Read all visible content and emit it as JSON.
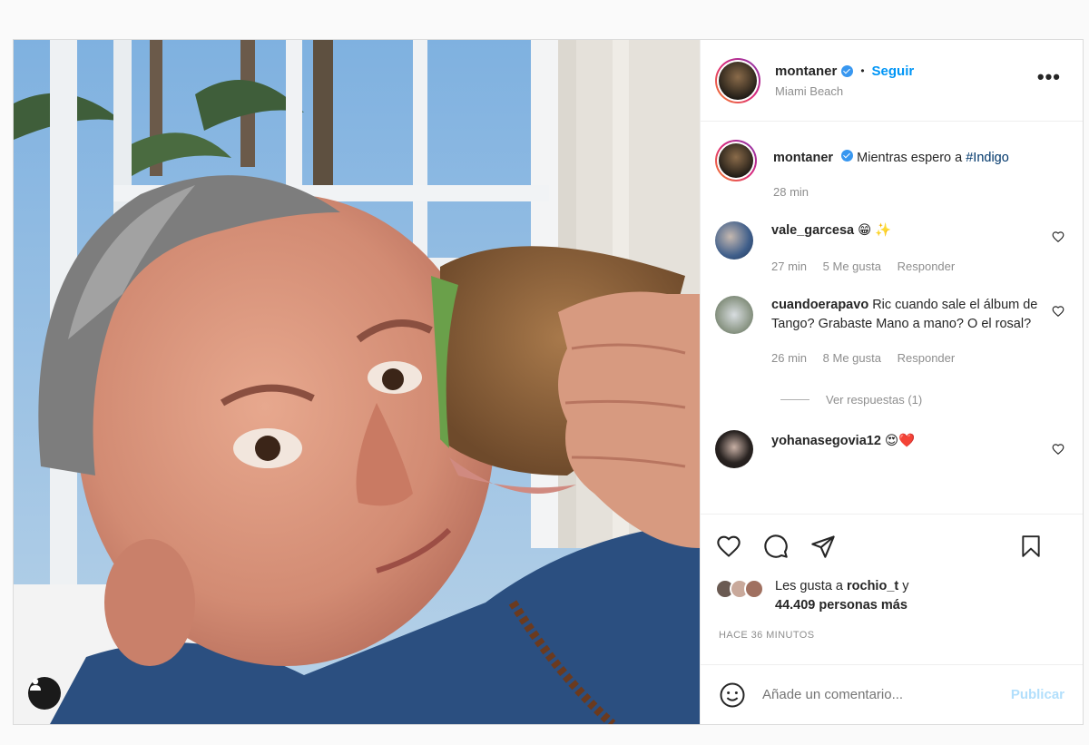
{
  "post": {
    "author": "montaner",
    "location": "Miami Beach",
    "follow_label": "Seguir",
    "separator": "•",
    "more_label": "•••"
  },
  "caption": {
    "author": "montaner",
    "text": "Mientras espero a",
    "hashtag": "#Indigo",
    "time": "28 min"
  },
  "comments": [
    {
      "user": "vale_garcesa",
      "text": "😁 ✨",
      "time": "27 min",
      "likes": "5 Me gusta",
      "reply": "Responder"
    },
    {
      "user": "cuandoerapavo",
      "text": "Ric cuando sale el álbum de Tango? Grabaste Mano a mano? O el rosal?",
      "time": "26 min",
      "likes": "8 Me gusta",
      "reply": "Responder",
      "view_replies": "Ver respuestas (1)"
    },
    {
      "user": "yohanasegovia12",
      "text": "😍❤️"
    }
  ],
  "likes": {
    "prefix": "Les gusta a",
    "user": "rochio_t",
    "conj": "y",
    "count_text": "44.409 personas más"
  },
  "timestamp": "HACE 36 MINUTOS",
  "composer": {
    "placeholder": "Añade un comentario...",
    "publish_label": "Publicar"
  },
  "colors": {
    "follow": "#0095f6",
    "verified": "#3897f0",
    "publish_disabled": "#b2dffc",
    "hashtag": "#00376b"
  },
  "icons": [
    "user-tag-icon",
    "verified-icon",
    "heart-icon",
    "comment-icon",
    "share-icon",
    "bookmark-icon",
    "emoji-icon"
  ]
}
